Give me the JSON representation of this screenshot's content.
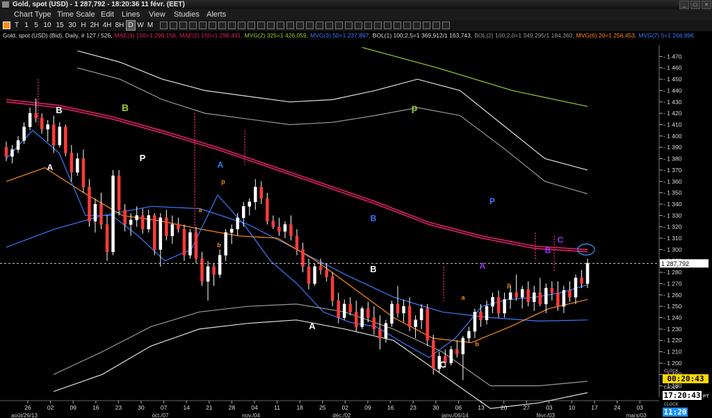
{
  "window": {
    "title": "Gold, spot (USD) - 1 287,792 - 18:20:36  11 févr. (EET)"
  },
  "menu": [
    "Chart Type",
    "Time Scale",
    "Edit",
    "Lines",
    "View",
    "Studies",
    "Alerts"
  ],
  "toolbar": {
    "intervals": [
      "T",
      "1",
      "5",
      "10",
      "15",
      "30",
      "H",
      "2H",
      "4H",
      "8H",
      "D",
      "W",
      "M"
    ],
    "selected": "D"
  },
  "legend": [
    {
      "text": "Gold, spot (USD) (Bid), Daily, # 127 / 526,",
      "color": "#dddddd"
    },
    {
      "text": "MAE(1) 150=1 298,158,",
      "color": "#e0206a"
    },
    {
      "text": "MAE(2) 150=1 298,431,",
      "color": "#e0206a"
    },
    {
      "text": "MVG(2) 325=1 426,059,",
      "color": "#9acd32"
    },
    {
      "text": "MVG(3) 50=1 237,897,",
      "color": "#3b7bff"
    },
    {
      "text": "BOL(1) 100;2,5=1 369,912/1 163,743,",
      "color": "#dddddd"
    },
    {
      "text": "BOL(2) 100;2,0=1 349,295/1 184,360,",
      "color": "#999999"
    },
    {
      "text": "MVG(6) 20=1 256,453,",
      "color": "#ff8c1a"
    },
    {
      "text": "MVG(7) 5=1 268,896",
      "color": "#3b7bff"
    }
  ],
  "chart_data": {
    "type": "candlestick",
    "instrument": "Gold, spot (USD)",
    "last_price": 1287.792,
    "last_price_label": "1 287,792",
    "ylim": [
      1170,
      1480
    ],
    "y_ticks": [
      1470,
      1460,
      1450,
      1440,
      1430,
      1420,
      1410,
      1400,
      1390,
      1380,
      1370,
      1360,
      1350,
      1340,
      1330,
      1320,
      1310,
      1300,
      1290,
      1280,
      1270,
      1260,
      1250,
      1240,
      1230,
      1220,
      1210,
      1200,
      1190,
      1180
    ],
    "x_ticks": [
      "26",
      "02",
      "09",
      "16",
      "23",
      "30",
      "07",
      "14",
      "21",
      "28",
      "04",
      "11",
      "18",
      "25",
      "02",
      "09",
      "16",
      "23",
      "30",
      "06",
      "13",
      "20",
      "27",
      "03",
      "10",
      "17",
      "24",
      "03"
    ],
    "x_month_labels": [
      {
        "label": "août/26/13",
        "tick_index": 0
      },
      {
        "label": "oct./07",
        "tick_index": 6
      },
      {
        "label": "nov./04",
        "tick_index": 10
      },
      {
        "label": "déc./02",
        "tick_index": 14
      },
      {
        "label": "janv./06/14",
        "tick_index": 19
      },
      {
        "label": "févr./03",
        "tick_index": 23
      },
      {
        "label": "mars/03",
        "tick_index": 27
      }
    ],
    "candles": [
      [
        1390,
        1395,
        1378,
        1382
      ],
      [
        1382,
        1392,
        1376,
        1388
      ],
      [
        1388,
        1400,
        1385,
        1396
      ],
      [
        1396,
        1412,
        1393,
        1408
      ],
      [
        1408,
        1425,
        1405,
        1420
      ],
      [
        1420,
        1433,
        1412,
        1416
      ],
      [
        1416,
        1420,
        1402,
        1406
      ],
      [
        1406,
        1414,
        1395,
        1410
      ],
      [
        1410,
        1418,
        1385,
        1392
      ],
      [
        1392,
        1412,
        1390,
        1408
      ],
      [
        1408,
        1410,
        1382,
        1385
      ],
      [
        1385,
        1392,
        1360,
        1368
      ],
      [
        1368,
        1385,
        1365,
        1380
      ],
      [
        1380,
        1388,
        1350,
        1355
      ],
      [
        1355,
        1362,
        1320,
        1325
      ],
      [
        1325,
        1345,
        1315,
        1340
      ],
      [
        1340,
        1350,
        1318,
        1322
      ],
      [
        1322,
        1330,
        1290,
        1298
      ],
      [
        1298,
        1370,
        1295,
        1365
      ],
      [
        1365,
        1370,
        1330,
        1335
      ],
      [
        1335,
        1340,
        1316,
        1322
      ],
      [
        1322,
        1332,
        1312,
        1326
      ],
      [
        1326,
        1338,
        1320,
        1330
      ],
      [
        1330,
        1336,
        1314,
        1318
      ],
      [
        1318,
        1335,
        1315,
        1330
      ],
      [
        1330,
        1332,
        1295,
        1300
      ],
      [
        1300,
        1332,
        1285,
        1328
      ],
      [
        1328,
        1335,
        1308,
        1312
      ],
      [
        1312,
        1330,
        1305,
        1322
      ],
      [
        1322,
        1328,
        1315,
        1318
      ],
      [
        1318,
        1322,
        1290,
        1295
      ],
      [
        1295,
        1318,
        1292,
        1315
      ],
      [
        1315,
        1320,
        1288,
        1292
      ],
      [
        1292,
        1298,
        1268,
        1272
      ],
      [
        1272,
        1290,
        1255,
        1285
      ],
      [
        1285,
        1288,
        1268,
        1278
      ],
      [
        1278,
        1300,
        1275,
        1295
      ],
      [
        1295,
        1318,
        1290,
        1315
      ],
      [
        1315,
        1322,
        1305,
        1318
      ],
      [
        1318,
        1332,
        1312,
        1328
      ],
      [
        1328,
        1342,
        1320,
        1338
      ],
      [
        1338,
        1345,
        1330,
        1342
      ],
      [
        1342,
        1362,
        1335,
        1355
      ],
      [
        1355,
        1360,
        1340,
        1345
      ],
      [
        1345,
        1350,
        1322,
        1325
      ],
      [
        1325,
        1330,
        1318,
        1320
      ],
      [
        1320,
        1328,
        1312,
        1316
      ],
      [
        1316,
        1325,
        1310,
        1322
      ],
      [
        1322,
        1330,
        1308,
        1312
      ],
      [
        1312,
        1318,
        1295,
        1300
      ],
      [
        1300,
        1306,
        1280,
        1285
      ],
      [
        1285,
        1292,
        1265,
        1270
      ],
      [
        1270,
        1288,
        1268,
        1285
      ],
      [
        1285,
        1292,
        1278,
        1282
      ],
      [
        1282,
        1288,
        1272,
        1276
      ],
      [
        1276,
        1280,
        1250,
        1255
      ],
      [
        1255,
        1262,
        1235,
        1240
      ],
      [
        1240,
        1256,
        1238,
        1252
      ],
      [
        1252,
        1258,
        1242,
        1245
      ],
      [
        1245,
        1255,
        1228,
        1232
      ],
      [
        1232,
        1250,
        1230,
        1248
      ],
      [
        1248,
        1254,
        1236,
        1240
      ],
      [
        1240,
        1250,
        1225,
        1230
      ],
      [
        1230,
        1242,
        1212,
        1222
      ],
      [
        1222,
        1238,
        1218,
        1235
      ],
      [
        1235,
        1255,
        1232,
        1252
      ],
      [
        1252,
        1268,
        1240,
        1244
      ],
      [
        1244,
        1256,
        1236,
        1250
      ],
      [
        1250,
        1258,
        1228,
        1232
      ],
      [
        1232,
        1242,
        1222,
        1238
      ],
      [
        1238,
        1252,
        1230,
        1248
      ],
      [
        1248,
        1252,
        1215,
        1220
      ],
      [
        1220,
        1225,
        1190,
        1195
      ],
      [
        1195,
        1210,
        1192,
        1206
      ],
      [
        1206,
        1212,
        1196,
        1200
      ],
      [
        1200,
        1215,
        1198,
        1212
      ],
      [
        1212,
        1220,
        1205,
        1208
      ],
      [
        1208,
        1224,
        1185,
        1222
      ],
      [
        1222,
        1232,
        1218,
        1228
      ],
      [
        1228,
        1248,
        1222,
        1245
      ],
      [
        1245,
        1252,
        1232,
        1238
      ],
      [
        1238,
        1255,
        1234,
        1250
      ],
      [
        1250,
        1262,
        1244,
        1258
      ],
      [
        1258,
        1264,
        1240,
        1244
      ],
      [
        1244,
        1262,
        1240,
        1256
      ],
      [
        1256,
        1268,
        1248,
        1262
      ],
      [
        1262,
        1278,
        1255,
        1258
      ],
      [
        1258,
        1268,
        1248,
        1265
      ],
      [
        1265,
        1272,
        1250,
        1254
      ],
      [
        1254,
        1268,
        1246,
        1262
      ],
      [
        1262,
        1275,
        1250,
        1252
      ],
      [
        1252,
        1270,
        1244,
        1266
      ],
      [
        1266,
        1272,
        1255,
        1262
      ],
      [
        1262,
        1272,
        1246,
        1250
      ],
      [
        1250,
        1268,
        1244,
        1264
      ],
      [
        1264,
        1272,
        1254,
        1258
      ],
      [
        1258,
        1278,
        1252,
        1275
      ],
      [
        1275,
        1282,
        1266,
        1270
      ],
      [
        1270,
        1292,
        1266,
        1288
      ]
    ],
    "series": [
      {
        "name": "MAE(1) 150",
        "color": "#e0206a",
        "values": [
          1430,
          1425,
          1415,
          1402,
          1388,
          1372,
          1356,
          1340,
          1322,
          1310,
          1301,
          1298
        ]
      },
      {
        "name": "MAE(2) 150",
        "color": "#e0206a",
        "values": [
          1432,
          1427,
          1417,
          1404,
          1390,
          1374,
          1358,
          1342,
          1324,
          1312,
          1303,
          1300
        ]
      },
      {
        "name": "MVG(2) 325",
        "color": "#9acd32",
        "values": [
          1478,
          1460,
          1440,
          1426
        ]
      },
      {
        "name": "MVG(3) 50",
        "color": "#3b7bff",
        "values": [
          1302,
          1318,
          1330,
          1338,
          1336,
          1322,
          1300,
          1278,
          1258,
          1245,
          1240,
          1237,
          1238
        ]
      },
      {
        "name": "MVG(6) 20",
        "color": "#ff8c1a",
        "values": [
          1360,
          1372,
          1350,
          1330,
          1325,
          1318,
          1312,
          1310,
          1290,
          1265,
          1240,
          1222,
          1218,
          1232,
          1248,
          1256
        ]
      },
      {
        "name": "MVG(7) 5",
        "color": "#3b7bff",
        "values": [
          1380,
          1405,
          1385,
          1330,
          1330,
          1312,
          1290,
          1300,
          1348,
          1322,
          1290,
          1270,
          1245,
          1236,
          1232,
          1218,
          1205,
          1222,
          1250,
          1256,
          1258,
          1262,
          1269
        ]
      },
      {
        "name": "BOL(1) upper",
        "color": "#dddddd",
        "values": [
          1475,
          1465,
          1450,
          1440,
          1435,
          1430,
          1432,
          1440,
          1450,
          1440,
          1410,
          1380,
          1370
        ]
      },
      {
        "name": "BOL(1) lower",
        "color": "#dddddd",
        "values": [
          1175,
          1190,
          1215,
          1230,
          1235,
          1238,
          1230,
          1220,
          1190,
          1160,
          1165,
          1174
        ]
      },
      {
        "name": "BOL(2) upper",
        "color": "#999999",
        "values": [
          1460,
          1450,
          1432,
          1420,
          1415,
          1410,
          1412,
          1418,
          1425,
          1418,
          1390,
          1360,
          1349
        ]
      },
      {
        "name": "BOL(2) lower",
        "color": "#999999",
        "values": [
          1190,
          1210,
          1232,
          1245,
          1250,
          1252,
          1245,
          1230,
          1210,
          1180,
          1180,
          1184
        ]
      }
    ],
    "annotations": [
      {
        "text": "B",
        "color": "#ffffff"
      },
      {
        "text": "B",
        "color": "#9acd32"
      },
      {
        "text": "A",
        "color": "#ffffff"
      },
      {
        "text": "P",
        "color": "#ffffff"
      },
      {
        "text": "A",
        "color": "#3b7bff"
      },
      {
        "text": "p",
        "color": "#ff8c1a"
      },
      {
        "text": "a",
        "color": "#ff8c1a"
      },
      {
        "text": "b",
        "color": "#ff8c1a"
      },
      {
        "text": "p",
        "color": "#9acd32"
      },
      {
        "text": "B",
        "color": "#3b7bff"
      },
      {
        "text": "P",
        "color": "#3b7bff"
      },
      {
        "text": "B",
        "color": "#ffffff"
      },
      {
        "text": "A",
        "color": "#ffffff"
      },
      {
        "text": "C",
        "color": "#ffffff"
      },
      {
        "text": "a",
        "color": "#ff8c1a"
      },
      {
        "text": "b",
        "color": "#ff8c1a"
      },
      {
        "text": "p",
        "color": "#ff8c1a"
      },
      {
        "text": "A",
        "color": "#9933ff"
      },
      {
        "text": "B",
        "color": "#9933ff"
      },
      {
        "text": "C",
        "color": "#9933ff"
      }
    ],
    "grid": false,
    "legend_position": "top-left"
  },
  "clock": {
    "label1": "CLOCK",
    "value1": "00:20:43",
    "label2": "CLOCK",
    "value2": "17:20:43",
    "value2_suffix": "PT",
    "label3": "CLOCK",
    "value3": "11:20"
  }
}
